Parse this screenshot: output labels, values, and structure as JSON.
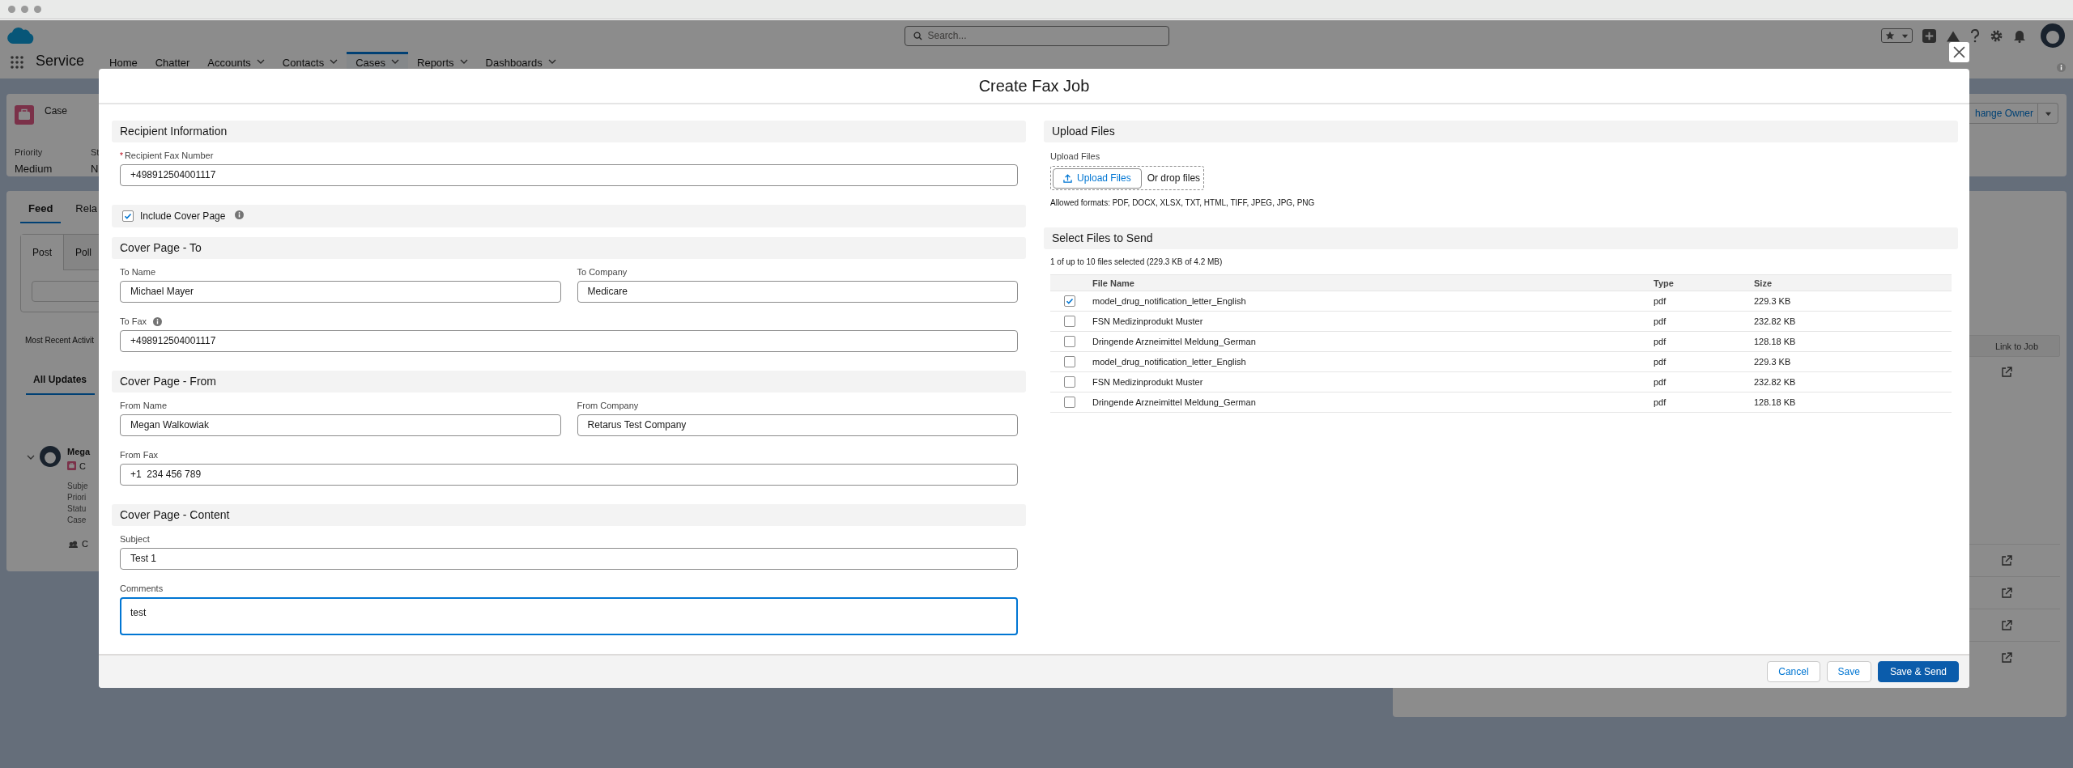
{
  "app": {
    "name": "Service",
    "search": {
      "placeholder": "Search..."
    },
    "nav": [
      {
        "label": "Home",
        "menu": false,
        "selected": false
      },
      {
        "label": "Chatter",
        "menu": false,
        "selected": false
      },
      {
        "label": "Accounts",
        "menu": true,
        "selected": false
      },
      {
        "label": "Contacts",
        "menu": true,
        "selected": false
      },
      {
        "label": "Cases",
        "menu": true,
        "selected": true
      },
      {
        "label": "Reports",
        "menu": true,
        "selected": false
      },
      {
        "label": "Dashboards",
        "menu": true,
        "selected": false
      }
    ]
  },
  "record": {
    "object": "Case",
    "fields": [
      {
        "label": "Priority",
        "value": "Medium"
      },
      {
        "label": "St",
        "value": "N"
      }
    ],
    "action": "hange Owner"
  },
  "feed": {
    "tabs": [
      {
        "label": "Feed",
        "selected": true
      },
      {
        "label": "Rela",
        "selected": false
      }
    ],
    "publisher_tabs": [
      {
        "label": "Post",
        "selected": true
      },
      {
        "label": "Poll",
        "selected": false
      }
    ],
    "sort": "Most Recent Activit",
    "filter": "All Updates",
    "post": {
      "author": "Mega",
      "record": "C",
      "fields": [
        "Subje",
        "Priori",
        "Statu",
        "Case"
      ],
      "action": "C"
    }
  },
  "related": {
    "column": "Link to Job"
  },
  "modal": {
    "title": "Create Fax Job",
    "left_sections": [
      {
        "kind": "section",
        "title": "Recipient Information",
        "rows": [
          [
            {
              "kind": "text",
              "label": "Recipient Fax Number",
              "required_mark": "*",
              "value": "+498912504001117"
            }
          ]
        ]
      },
      {
        "kind": "checkbox",
        "label": "Include Cover Page",
        "checked": true,
        "info": true
      },
      {
        "kind": "section",
        "title": "Cover Page - To",
        "rows": [
          [
            {
              "kind": "text",
              "label": "To Name",
              "value": "Michael Mayer"
            },
            {
              "kind": "text",
              "label": "To Company",
              "value": "Medicare"
            }
          ],
          [
            {
              "kind": "text",
              "label": "To Fax",
              "info": true,
              "value": "+498912504001117"
            }
          ]
        ]
      },
      {
        "kind": "section",
        "title": "Cover Page - From",
        "rows": [
          [
            {
              "kind": "text",
              "label": "From Name",
              "value": "Megan Walkowiak"
            },
            {
              "kind": "text",
              "label": "From Company",
              "value": "Retarus Test Company"
            }
          ],
          [
            {
              "kind": "text",
              "label": "From Fax",
              "value": "+1  234 456 789"
            }
          ]
        ]
      },
      {
        "kind": "section",
        "title": "Cover Page - Content",
        "rows": [
          [
            {
              "kind": "text",
              "label": "Subject",
              "value": "Test 1"
            }
          ],
          [
            {
              "kind": "textarea",
              "label": "Comments",
              "value": "test",
              "focused": true
            }
          ]
        ]
      }
    ],
    "upload": {
      "title": "Upload Files",
      "label": "Upload Files",
      "button": "Upload Files",
      "drop_text": "Or drop files",
      "formats": "Allowed formats: PDF, DOCX, XLSX, TXT, HTML, TIFF, JPEG, JPG, PNG"
    },
    "files": {
      "title": "Select Files to Send",
      "summary": "1 of up to 10 files selected (229.3 KB of 4.2 MB)",
      "columns": [
        "File Name",
        "Type",
        "Size"
      ],
      "rows": [
        {
          "selected": true,
          "name": "model_drug_notification_letter_English",
          "type": "pdf",
          "size": "229.3 KB"
        },
        {
          "selected": false,
          "name": "FSN Medizinprodukt Muster",
          "type": "pdf",
          "size": "232.82 KB"
        },
        {
          "selected": false,
          "name": "Dringende Arzneimittel Meldung_German",
          "type": "pdf",
          "size": "128.18 KB"
        },
        {
          "selected": false,
          "name": "model_drug_notification_letter_English",
          "type": "pdf",
          "size": "229.3 KB"
        },
        {
          "selected": false,
          "name": "FSN Medizinprodukt Muster",
          "type": "pdf",
          "size": "232.82 KB"
        },
        {
          "selected": false,
          "name": "Dringende Arzneimittel Meldung_German",
          "type": "pdf",
          "size": "128.18 KB"
        }
      ]
    },
    "buttons": [
      {
        "kind": "neutral",
        "label": "Cancel"
      },
      {
        "kind": "neutral",
        "label": "Save"
      },
      {
        "kind": "brand",
        "label": "Save & Send"
      }
    ]
  }
}
